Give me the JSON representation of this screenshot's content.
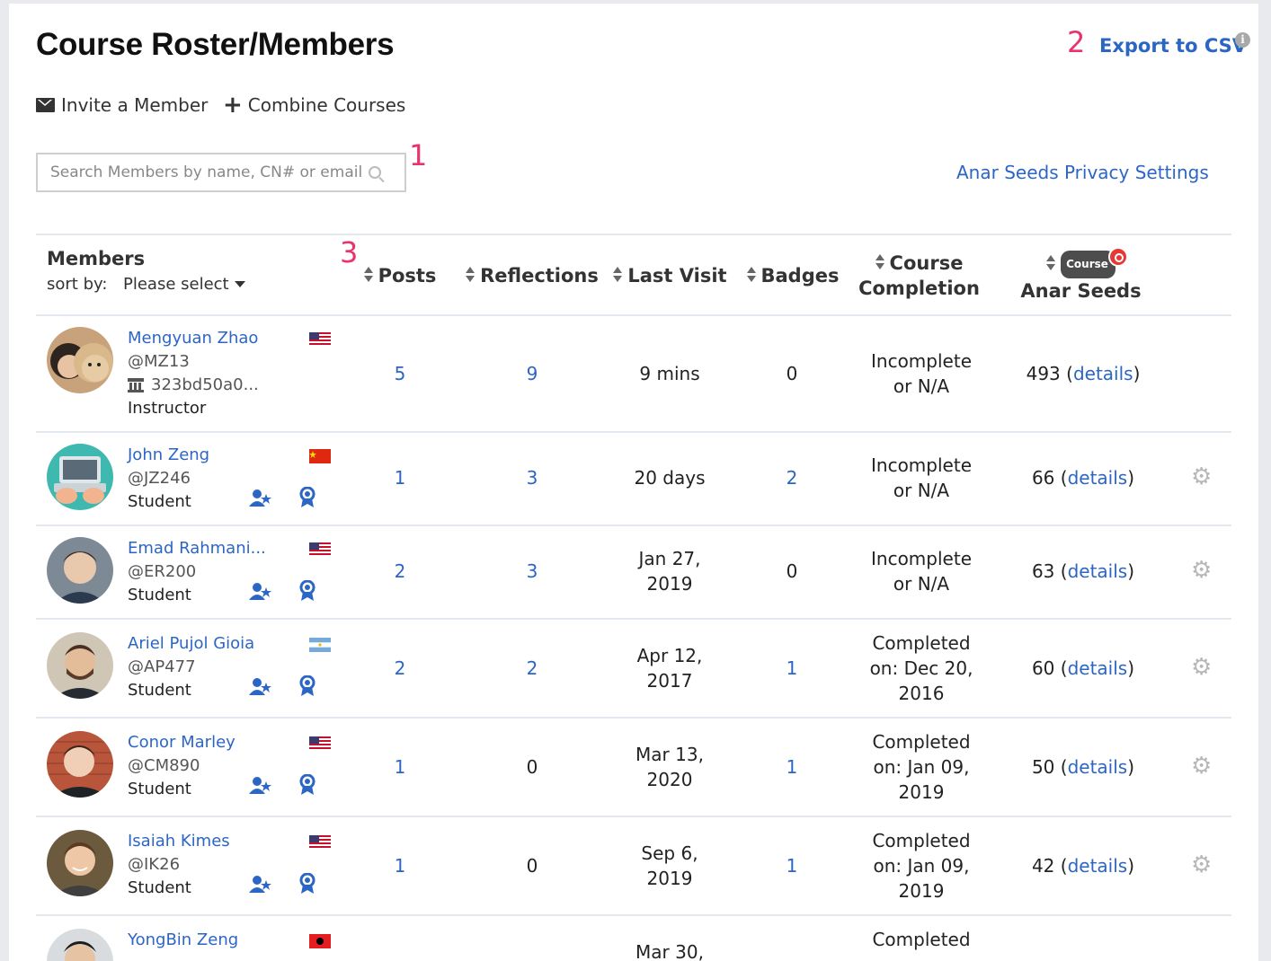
{
  "page": {
    "title": "Course Roster/Members",
    "export_label": "Export to CSV",
    "info_icon": "info-icon",
    "annotations": {
      "search": "1",
      "export": "2",
      "columns": "3"
    }
  },
  "actions": {
    "invite_label": "Invite a Member",
    "combine_label": "Combine Courses",
    "invite_icon": "envelope-icon",
    "combine_icon": "plus-icon"
  },
  "search": {
    "placeholder": "Search Members by name, CN# or email",
    "icon": "search-icon"
  },
  "privacy_label": "Anar Seeds Privacy Settings",
  "table": {
    "members_header": "Members",
    "sort_by_label": "sort by:",
    "sort_by_value": "Please select",
    "headers": {
      "posts": "Posts",
      "reflections": "Reflections",
      "last_visit": "Last Visit",
      "badges": "Badges",
      "completion_line1": "Course",
      "completion_line2": "Completion",
      "seeds_pill": "Course",
      "seeds": "Anar Seeds"
    }
  },
  "colors": {
    "link": "#2c66c4",
    "annotation": "#e8336d",
    "gear": "#b7b7b7"
  },
  "members": [
    {
      "name": "Mengyuan Zhao",
      "handle": "@MZ13",
      "institution": "323bd50a0...",
      "role": "Instructor",
      "flag": "us",
      "posts": "5",
      "reflections": "9",
      "last_visit_1": "9 mins",
      "last_visit_2": "",
      "badges": "0",
      "completion_1": "Incomplete",
      "completion_2": "or N/A",
      "completion_3": "",
      "seeds": "493",
      "details": "details"
    },
    {
      "name": "John Zeng",
      "handle": "@JZ246",
      "role": "Student",
      "flag": "cn",
      "posts": "1",
      "reflections": "3",
      "last_visit_1": "20 days",
      "last_visit_2": "",
      "badges": "2",
      "completion_1": "Incomplete",
      "completion_2": "or N/A",
      "completion_3": "",
      "seeds": "66",
      "details": "details"
    },
    {
      "name": "Emad Rahmani...",
      "handle": "@ER200",
      "role": "Student",
      "flag": "us",
      "posts": "2",
      "reflections": "3",
      "last_visit_1": "Jan 27,",
      "last_visit_2": "2019",
      "badges": "0",
      "completion_1": "Incomplete",
      "completion_2": "or N/A",
      "completion_3": "",
      "seeds": "63",
      "details": "details"
    },
    {
      "name": "Ariel Pujol Gioia",
      "handle": "@AP477",
      "role": "Student",
      "flag": "ar",
      "posts": "2",
      "reflections": "2",
      "last_visit_1": "Apr 12,",
      "last_visit_2": "2017",
      "badges": "1",
      "completion_1": "Completed",
      "completion_2": "on: Dec 20,",
      "completion_3": "2016",
      "seeds": "60",
      "details": "details"
    },
    {
      "name": "Conor Marley",
      "handle": "@CM890",
      "role": "Student",
      "flag": "us",
      "posts": "1",
      "reflections": "0",
      "last_visit_1": "Mar 13,",
      "last_visit_2": "2020",
      "badges": "1",
      "completion_1": "Completed",
      "completion_2": "on: Jan 09,",
      "completion_3": "2019",
      "seeds": "50",
      "details": "details"
    },
    {
      "name": "Isaiah Kimes",
      "handle": "@IK26",
      "role": "Student",
      "flag": "us",
      "posts": "1",
      "reflections": "0",
      "last_visit_1": "Sep 6,",
      "last_visit_2": "2019",
      "badges": "1",
      "completion_1": "Completed",
      "completion_2": "on: Jan 09,",
      "completion_3": "2019",
      "seeds": "42",
      "details": "details"
    },
    {
      "name": "YongBin Zeng",
      "flag": "al",
      "last_visit_1": "Mar 30,",
      "completion_1": "Completed"
    }
  ]
}
